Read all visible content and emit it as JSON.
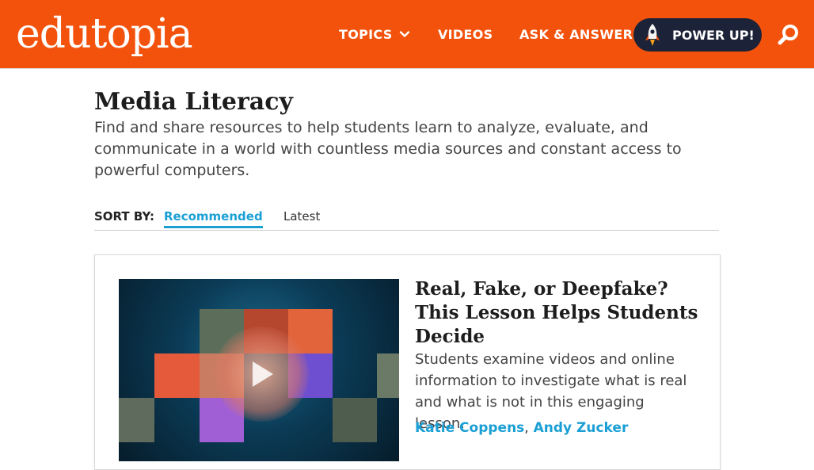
{
  "header": {
    "logo_text": "edutopia",
    "nav": {
      "topics": "TOPICS",
      "videos": "VIDEOS",
      "ask_answer": "ASK & ANSWER",
      "power_up": "POWER UP!"
    },
    "icons": {
      "topics_chevron": "chevron-down-icon",
      "power_up": "rocket-icon",
      "search": "search-icon"
    }
  },
  "page": {
    "title": "Media Literacy",
    "description": "Find and share resources to help students learn to analyze, evaluate, and communicate in a world with countless media sources and constant access to powerful computers."
  },
  "sort": {
    "label": "SORT BY:",
    "options": [
      "Recommended",
      "Latest"
    ],
    "selected": "Recommended"
  },
  "articles": [
    {
      "title": "Real, Fake, or Deepfake? This Lesson Helps Students Decide",
      "summary": "Students examine videos and online information to investigate what is real and what is not in this engaging lesson.",
      "authors": [
        "Katie Coppens",
        "Andy Zucker"
      ],
      "author_separator": ",",
      "thumbnail_icon": "play-icon"
    }
  ],
  "colors": {
    "brand_orange": "#f3520c",
    "accent_blue": "#1a9fd4",
    "power_up_navy": "#1c2237"
  }
}
